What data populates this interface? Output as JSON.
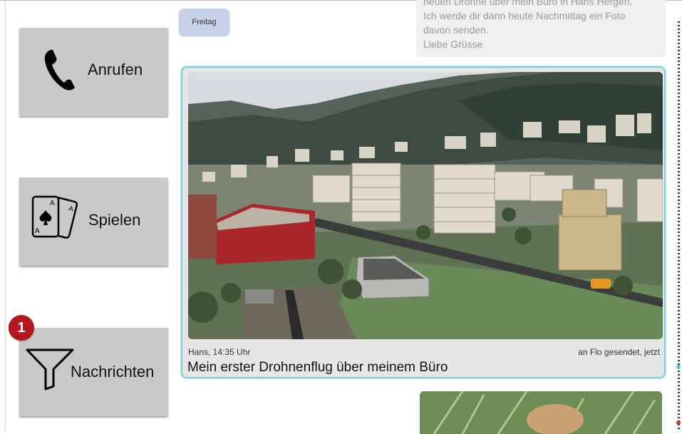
{
  "sidebar": {
    "call_label": "Anrufen",
    "play_label": "Spielen",
    "messages_label": "Nachrichten",
    "messages_badge": "1",
    "call_icon": "phone-icon",
    "play_icon": "playing-cards-icon",
    "messages_icon": "filter-icon"
  },
  "chat": {
    "day_label": "Freitag",
    "previous_message_lines": [
      "neuen Drohne über mein Büro in Hans Hergen.",
      "Ich werde dir dann heute Nachmittag ein Foto",
      "davon senden.",
      "Liebe Grüsse"
    ],
    "active_message": {
      "sender_time": "Hans, 14:35 Uhr",
      "sent_status": "an Flo gesendet, jetzt",
      "caption": "Mein erster Drohnenflug über meinem Büro"
    }
  },
  "colors": {
    "button_bg": "#c9c9c9",
    "badge": "#b3161d",
    "card_border": "#7fd0dc",
    "day_chip": "#c8d2e6"
  }
}
